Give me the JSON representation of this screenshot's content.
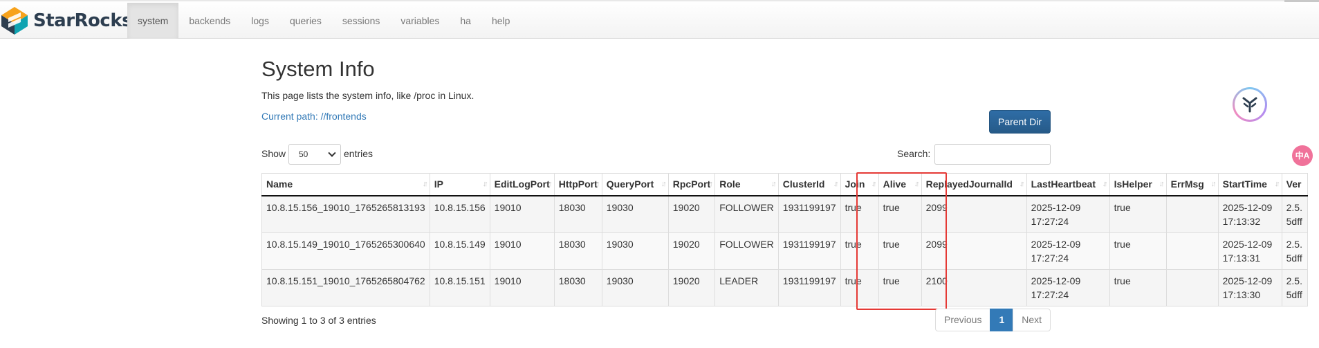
{
  "app": {
    "brand": "StarRocks"
  },
  "nav": {
    "items": [
      "system",
      "backends",
      "logs",
      "queries",
      "sessions",
      "variables",
      "ha",
      "help"
    ],
    "active": "system"
  },
  "page": {
    "title": "System Info",
    "description": "This page lists the system info, like /proc in Linux.",
    "current_path": "Current path: //frontends",
    "parent_button": "Parent Dir"
  },
  "controls": {
    "show_label": "Show",
    "entries_value": "50",
    "entries_label": "entries",
    "search_label": "Search:",
    "search_value": ""
  },
  "table": {
    "columns": [
      "Name",
      "IP",
      "EditLogPort",
      "HttpPort",
      "QueryPort",
      "RpcPort",
      "Role",
      "ClusterId",
      "Join",
      "Alive",
      "ReplayedJournalId",
      "LastHeartbeat",
      "IsHelper",
      "ErrMsg",
      "StartTime",
      "Ver"
    ],
    "rows": [
      [
        "10.8.15.156_19010_1765265813193",
        "10.8.15.156",
        "19010",
        "18030",
        "19030",
        "19020",
        "FOLLOWER",
        "1931199197",
        "true",
        "true",
        "2099",
        "2025-12-09 17:27:24",
        "true",
        "",
        "2025-12-09 17:13:32",
        "2.5. 5dff"
      ],
      [
        "10.8.15.149_19010_1765265300640",
        "10.8.15.149",
        "19010",
        "18030",
        "19030",
        "19020",
        "FOLLOWER",
        "1931199197",
        "true",
        "true",
        "2099",
        "2025-12-09 17:27:24",
        "true",
        "",
        "2025-12-09 17:13:31",
        "2.5. 5dff"
      ],
      [
        "10.8.15.151_19010_1765265804762",
        "10.8.15.151",
        "19010",
        "18030",
        "19030",
        "19020",
        "LEADER",
        "1931199197",
        "true",
        "true",
        "2100",
        "2025-12-09 17:27:24",
        "true",
        "",
        "2025-12-09 17:13:30",
        "2.5. 5dff"
      ]
    ]
  },
  "footer": {
    "info": "Showing 1 to 3 of 3 entries",
    "previous": "Previous",
    "current_page": "1",
    "next": "Next"
  },
  "colors": {
    "primary": "#337ab7",
    "highlight": "#e53935",
    "brand_orange": "#f7a21b",
    "brand_navy": "#2d3e50"
  },
  "widgets": {
    "translate_label": "中A"
  }
}
